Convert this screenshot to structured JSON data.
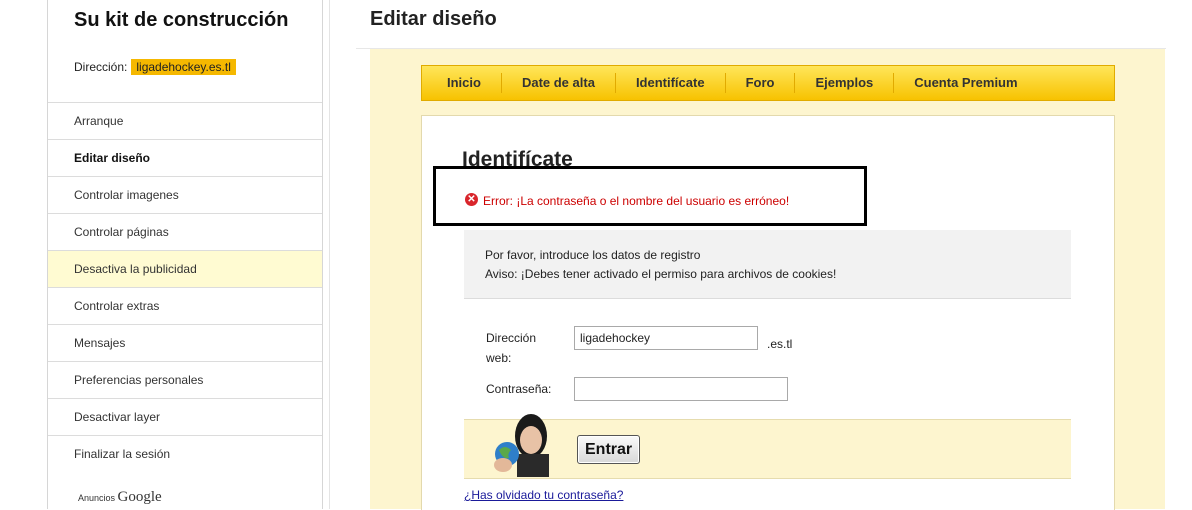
{
  "sidebar": {
    "title": "Su kit de construcción",
    "direccion_label": "Dirección:",
    "direccion_value": "ligadehockey.es.tl",
    "items": [
      {
        "label": "Arranque"
      },
      {
        "label": "Editar diseño"
      },
      {
        "label": "Controlar imagenes"
      },
      {
        "label": "Controlar páginas"
      },
      {
        "label": "Desactiva la publicidad"
      },
      {
        "label": "Controlar extras"
      },
      {
        "label": "Mensajes"
      },
      {
        "label": "Preferencias personales"
      },
      {
        "label": "Desactivar layer"
      },
      {
        "label": "Finalizar la sesión"
      }
    ],
    "ads_label": "Anuncios",
    "ads_brand": "Google"
  },
  "main": {
    "title": "Editar diseño",
    "nav": [
      "Inicio",
      "Date de alta",
      "Identifícate",
      "Foro",
      "Ejemplos",
      "Cuenta Premium"
    ],
    "login": {
      "heading": "Identifícate",
      "error": "Error: ¡La contraseña o el nombre del usuario es erróneo!",
      "info_line1": "Por favor, introduce los datos de registro",
      "info_line2": "Aviso: ¡Debes tener activado el permiso para archivos de cookies!",
      "dir_label_1": "Dirección",
      "dir_label_2": "web:",
      "dir_value": "ligadehockey",
      "dir_suffix": ".es.tl",
      "password_label": "Contraseña:",
      "password_value": "",
      "submit_label": "Entrar",
      "forgot_link": "¿Has olvidado tu contraseña?"
    }
  },
  "colors": {
    "accent": "#f5b800",
    "panel": "#fdf5cf",
    "error": "#cc0000",
    "highlight": "#fffbd2"
  },
  "icons": {
    "error": "error-icon",
    "person": "person-with-globe-icon"
  }
}
